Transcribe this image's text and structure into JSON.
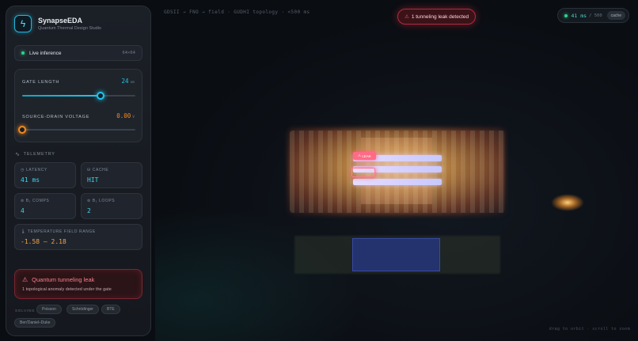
{
  "brand": {
    "name": "SynapseEDA",
    "subtitle": "Quantum Thermal Design Studio",
    "icon": "lightning-icon"
  },
  "status": {
    "label": "Live inference",
    "resolution": "64×64"
  },
  "controls": {
    "gate_length": {
      "label": "GATE LENGTH",
      "value": "24",
      "unit": "nm",
      "fraction": 0.69
    },
    "source_drain_voltage": {
      "label": "SOURCE-DRAIN VOLTAGE",
      "value": "0.00",
      "unit": "V",
      "fraction": 0.0
    }
  },
  "telemetry": {
    "title": "TELEMETRY",
    "latency": {
      "label": "LATENCY",
      "value": "41 ms"
    },
    "cache": {
      "label": "CACHE",
      "value": "HIT"
    },
    "comps": {
      "label": "β₁ COMPS",
      "value": "4"
    },
    "loops": {
      "label": "β₁ LOOPS",
      "value": "2"
    },
    "temp_range": {
      "label": "TEMPERATURE FIELD RANGE",
      "value": "-1.58 – 2.18"
    }
  },
  "alert": {
    "title": "Quantum tunneling leak",
    "message": "1 topological anomaly detected under the gate"
  },
  "solving": {
    "label": "SOLVING",
    "chips": [
      "Poisson",
      "Schrödinger",
      "BTE",
      "Ben'Daniel–Duke"
    ]
  },
  "viewport": {
    "subtitle": "GDSII → FNO → field · GUDHI topology · <500 ms",
    "leak_banner": "1 tunneling leak detected",
    "perf": {
      "latency": "41 ms",
      "budget": "/ 500",
      "cache": "cache"
    },
    "leak_tag": "LEAK",
    "hint": "drag to orbit · scroll to zoom"
  },
  "colors": {
    "accent_cyan": "#1fc4ea",
    "accent_orange": "#f38a1d",
    "ok_green": "#2fd38a",
    "danger_red": "#ff5a6c",
    "value_cyan": "#3fd3e8",
    "value_orange": "#f2a24a"
  }
}
